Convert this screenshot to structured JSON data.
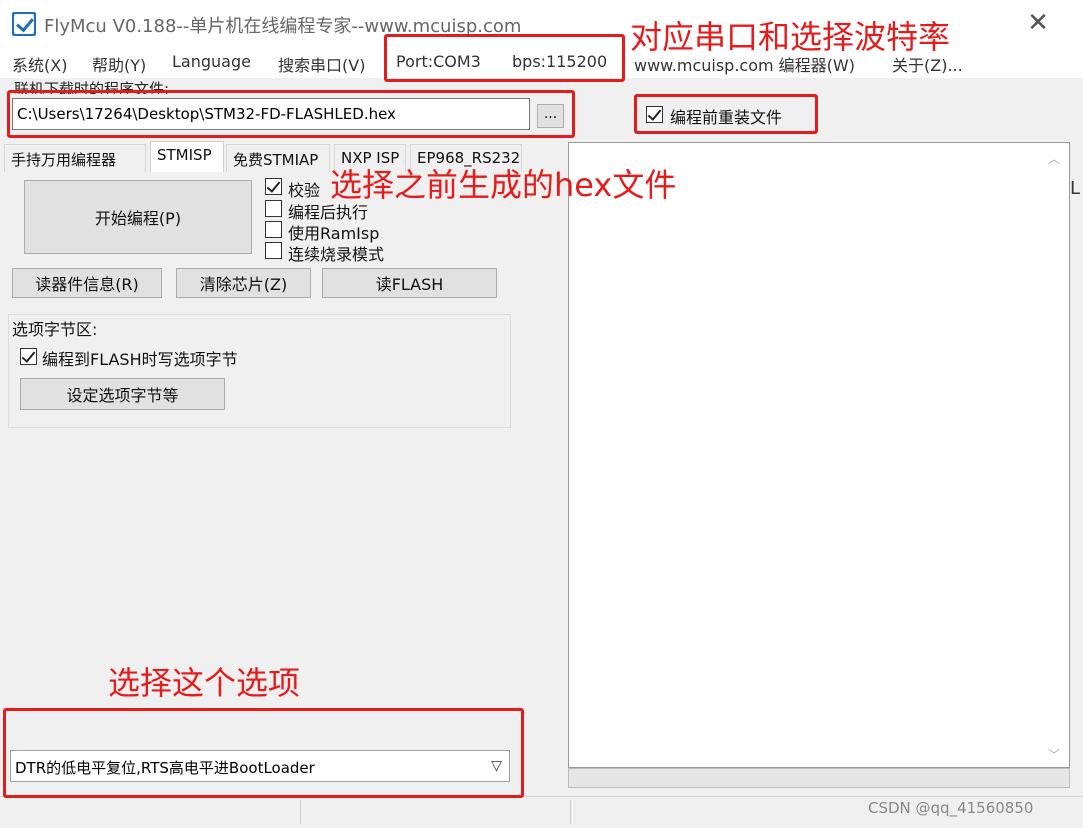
{
  "window": {
    "title": "FlyMcu V0.188--单片机在线编程专家--www.mcuisp.com",
    "close_glyph": "✕"
  },
  "menu": {
    "items": [
      "系统(X)",
      "帮助(Y)",
      "Language",
      "搜索串口(V)",
      "Port:COM3",
      "bps:115200",
      "www.mcuisp.com 编程器(W)",
      "关于(Z)..."
    ]
  },
  "file": {
    "label": "联机下载时的程序文件:",
    "path": "C:\\Users\\17264\\Desktop\\STM32-FD-FLASHLED.hex",
    "browse_label": "...",
    "reload_label": "编程前重装文件",
    "reload_checked": true
  },
  "tabs": [
    "手持万用编程器",
    "STMISP",
    "免费STMIAP",
    "NXP ISP",
    "EP968_RS232"
  ],
  "stmisp": {
    "start_button": "开始编程(P)",
    "options": [
      {
        "label": "校验",
        "checked": true
      },
      {
        "label": "编程后执行",
        "checked": false
      },
      {
        "label": "使用RamIsp",
        "checked": false
      },
      {
        "label": "连续烧录模式",
        "checked": false
      }
    ],
    "read_info_button": "读器件信息(R)",
    "erase_button": "清除芯片(Z)",
    "read_flash_button": "读FLASH"
  },
  "option_bytes": {
    "group_title": "选项字节区:",
    "write_label": "编程到FLASH时写选项字节",
    "write_checked": true,
    "set_button": "设定选项字节等"
  },
  "log": {
    "edge_text": "L"
  },
  "reset_mode": {
    "selected": "DTR的低电平复位,RTS高电平进BootLoader"
  },
  "annotations": {
    "port_note": "对应串口和选择波特率",
    "hex_note": "选择之前生成的hex文件",
    "option_note": "选择这个选项"
  },
  "watermark": "CSDN @qq_41560850",
  "colors": {
    "annotation": "#e51c1c",
    "app_icon": "#1f6fc0"
  }
}
